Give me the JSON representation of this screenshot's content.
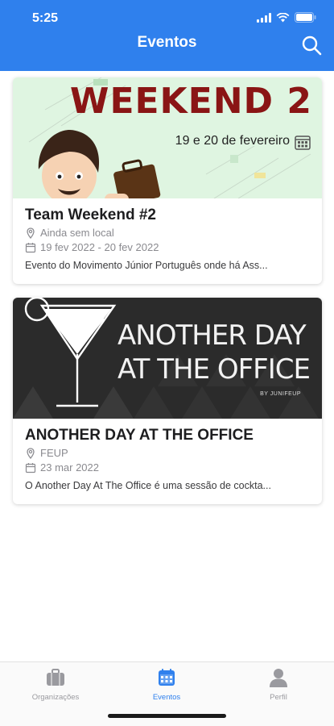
{
  "status_bar": {
    "time": "5:25"
  },
  "header": {
    "title": "Eventos",
    "search_icon": "search-icon"
  },
  "events": [
    {
      "banner": {
        "title": "WEEKEND 2",
        "date_text": "19 e 20 de fevereiro"
      },
      "title": "Team Weekend #2",
      "location": "Ainda sem local",
      "dates": "19 fev 2022 - 20 fev 2022",
      "description": "Evento do Movimento Júnior Português onde há Ass..."
    },
    {
      "banner": {
        "line1": "ANOTHER DAY",
        "line2": "AT THE OFFICE",
        "by": "BY JUNIFEUP"
      },
      "title": "ANOTHER DAY AT THE OFFICE",
      "location": "FEUP",
      "dates": "23 mar 2022",
      "description": "O Another Day At The Office é uma sessão de cockta..."
    }
  ],
  "tabbar": {
    "tabs": [
      {
        "label": "Organizações",
        "icon": "briefcase-icon",
        "active": false
      },
      {
        "label": "Eventos",
        "icon": "calendar-icon",
        "active": true
      },
      {
        "label": "Perfil",
        "icon": "person-icon",
        "active": false
      }
    ]
  },
  "colors": {
    "primary": "#2f80ed",
    "tab_inactive": "#9a9a9f",
    "weekend_title": "#8a1515"
  }
}
